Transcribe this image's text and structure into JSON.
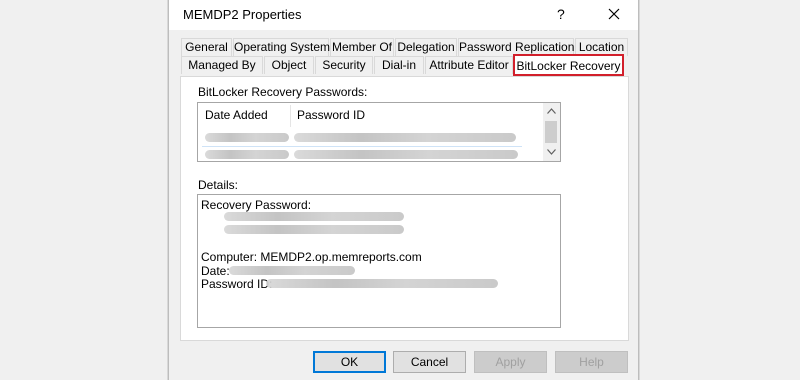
{
  "window": {
    "title": "MEMDP2 Properties",
    "help_label": "?",
    "close_icon": "close-icon"
  },
  "tabs": {
    "row1": [
      "General",
      "Operating System",
      "Member Of",
      "Delegation",
      "Password Replication",
      "Location"
    ],
    "row2": [
      "Managed By",
      "Object",
      "Security",
      "Dial-in",
      "Attribute Editor",
      "BitLocker Recovery"
    ],
    "active": "BitLocker Recovery",
    "highlight_color": "#d21f2b"
  },
  "passwords_section": {
    "label": "BitLocker Recovery Passwords:",
    "columns": [
      "Date Added",
      "Password ID"
    ]
  },
  "details_section": {
    "label": "Details:",
    "recovery_password_label": "Recovery Password:",
    "computer_line": "Computer: MEMDP2.op.memreports.com",
    "date_label": "Date:",
    "password_id_label": "Password ID:"
  },
  "buttons": {
    "ok": "OK",
    "cancel": "Cancel",
    "apply": "Apply",
    "help": "Help"
  },
  "colors": {
    "accent": "#0078d7",
    "window_bg": "#f0f0f0"
  }
}
